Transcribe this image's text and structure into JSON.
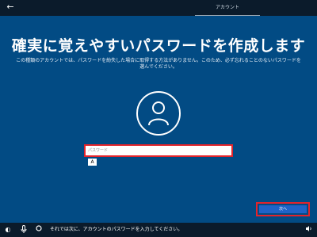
{
  "topbar": {
    "back_icon": "back-arrow-icon",
    "tab_label": "アカウント"
  },
  "main": {
    "title": "確実に覚えやすいパスワードを作成します",
    "description": "この種類のアカウントでは、パスワードを紛失した場合に取得する方法がありません。このため、必ず忘れることのないパスワードを選んでください。",
    "avatar_icon": "user-icon",
    "password": {
      "value": "",
      "placeholder": "パスワード"
    },
    "ime_indicator": "A",
    "next_label": "次へ"
  },
  "bottombar": {
    "icons": [
      "ease-of-access-icon",
      "microphone-icon",
      "cortana-circle-icon",
      "volume-icon"
    ],
    "status_text": "それでは次に、アカウントのパスワードを入力してください。"
  },
  "colors": {
    "background": "#024b84",
    "bar": "#0b1b2b",
    "button": "#1e63c7",
    "highlight": "#e3242b"
  }
}
